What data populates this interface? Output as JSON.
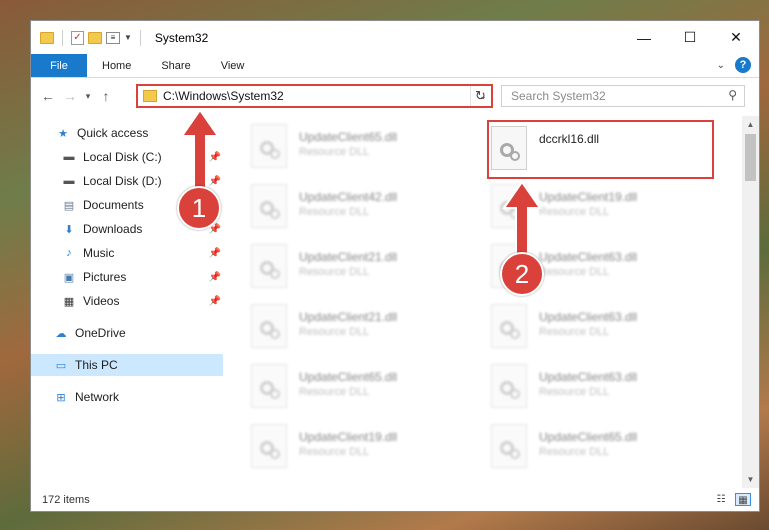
{
  "window": {
    "title": "System32",
    "minimize_glyph": "—",
    "maximize_glyph": "☐",
    "close_glyph": "✕"
  },
  "ribbon": {
    "tabs": [
      "File",
      "Home",
      "Share",
      "View"
    ],
    "help_glyph": "?"
  },
  "address": {
    "path": "C:\\Windows\\System32",
    "search_placeholder": "Search System32"
  },
  "sidebar": {
    "items": [
      {
        "label": "Quick access",
        "icon": "star-icon",
        "pinned": false
      },
      {
        "label": "Local Disk (C:)",
        "icon": "drive-icon",
        "pinned": true
      },
      {
        "label": "Local Disk (D:)",
        "icon": "drive-icon",
        "pinned": true
      },
      {
        "label": "Documents",
        "icon": "documents-icon",
        "pinned": true
      },
      {
        "label": "Downloads",
        "icon": "download-icon",
        "pinned": true
      },
      {
        "label": "Music",
        "icon": "music-icon",
        "pinned": true
      },
      {
        "label": "Pictures",
        "icon": "pictures-icon",
        "pinned": true
      },
      {
        "label": "Videos",
        "icon": "videos-icon",
        "pinned": true
      },
      {
        "label": "OneDrive",
        "icon": "cloud-icon",
        "pinned": false
      },
      {
        "label": "This PC",
        "icon": "computer-icon",
        "pinned": false
      },
      {
        "label": "Network",
        "icon": "network-icon",
        "pinned": false
      }
    ]
  },
  "files": [
    {
      "name": "UpdateClient65.dll",
      "type": "Resource DLL"
    },
    {
      "name": "dccrkl16.dll",
      "type": ""
    },
    {
      "name": "UpdateClient42.dll",
      "type": "Resource DLL"
    },
    {
      "name": "UpdateClient19.dll",
      "type": "Resource DLL"
    },
    {
      "name": "UpdateClient21.dll",
      "type": "Resource DLL"
    },
    {
      "name": "UpdateClient63.dll",
      "type": "Resource DLL"
    },
    {
      "name": "UpdateClient21.dll",
      "type": "Resource DLL"
    },
    {
      "name": "UpdateClient63.dll",
      "type": "Resource DLL"
    },
    {
      "name": "UpdateClient65.dll",
      "type": "Resource DLL"
    },
    {
      "name": "UpdateClient63.dll",
      "type": "Resource DLL"
    },
    {
      "name": "UpdateClient19.dll",
      "type": "Resource DLL"
    },
    {
      "name": "UpdateClient65.dll",
      "type": "Resource DLL"
    }
  ],
  "status": {
    "item_count": "172 items"
  },
  "callouts": {
    "one": "1",
    "two": "2"
  },
  "colors": {
    "accent": "#1979ca",
    "highlight": "#d9413a",
    "selected": "#cce8ff"
  }
}
